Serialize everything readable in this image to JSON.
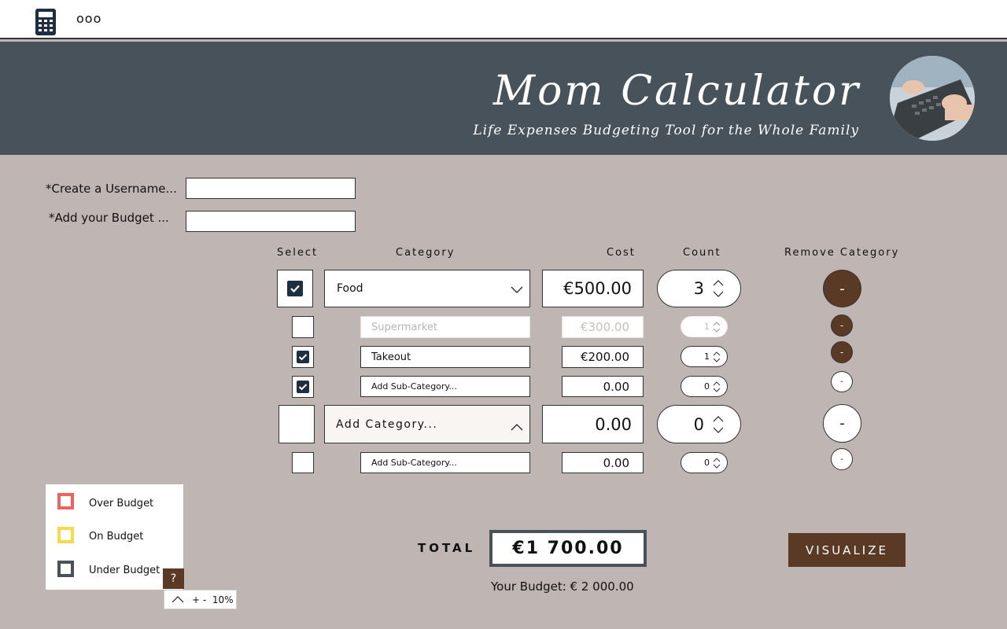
{
  "app": {
    "title": "Mom Calculator",
    "subtitle": "Life Expenses Budgeting Tool for the Whole Family",
    "menu_dots": "ooo"
  },
  "form": {
    "username_label": "*Create a Username...",
    "budget_label": "*Add your Budget ...",
    "username_value": "",
    "budget_value": ""
  },
  "columns": {
    "select": "Select",
    "category": "Category",
    "cost": "Cost",
    "count": "Count",
    "remove": "Remove Category"
  },
  "rows": [
    {
      "kind": "category",
      "checked": true,
      "name": "Food",
      "cost": "€500.00",
      "count": "3",
      "remove": "-"
    },
    {
      "kind": "sub",
      "checked": false,
      "name": "Supermarket",
      "cost": "€300.00",
      "count": "1",
      "remove": "-"
    },
    {
      "kind": "sub",
      "checked": true,
      "name": "Takeout",
      "cost": "€200.00",
      "count": "1",
      "remove": "-"
    },
    {
      "kind": "sub",
      "checked": true,
      "name": "Add Sub-Category...",
      "cost": "0.00",
      "count": "0",
      "remove": "-"
    },
    {
      "kind": "category",
      "checked": false,
      "name": "Add Category...",
      "cost": "0.00",
      "count": "0",
      "remove": "-"
    },
    {
      "kind": "sub",
      "checked": false,
      "name": "Add Sub-Category...",
      "cost": "0.00",
      "count": "0",
      "remove": "-"
    }
  ],
  "legend": {
    "over": {
      "label": "Over Budget",
      "color": "#f06262"
    },
    "on": {
      "label": "On Budget",
      "color": "#f7d94c"
    },
    "under": {
      "label": "Under Budget",
      "color": "#48525a"
    },
    "help": "?",
    "tolerance": "+ -  10%"
  },
  "total": {
    "label": "TOTAL",
    "value": "€1 700.00",
    "budget_text": "Your Budget: € 2 000.00"
  },
  "visualize_label": "VISUALIZE",
  "icons": {
    "app": "calculator-icon",
    "check": "checkmark-icon",
    "dropdown": "chevron-down-icon",
    "collapse": "chevron-up-icon",
    "spinner": "stepper-icon"
  }
}
